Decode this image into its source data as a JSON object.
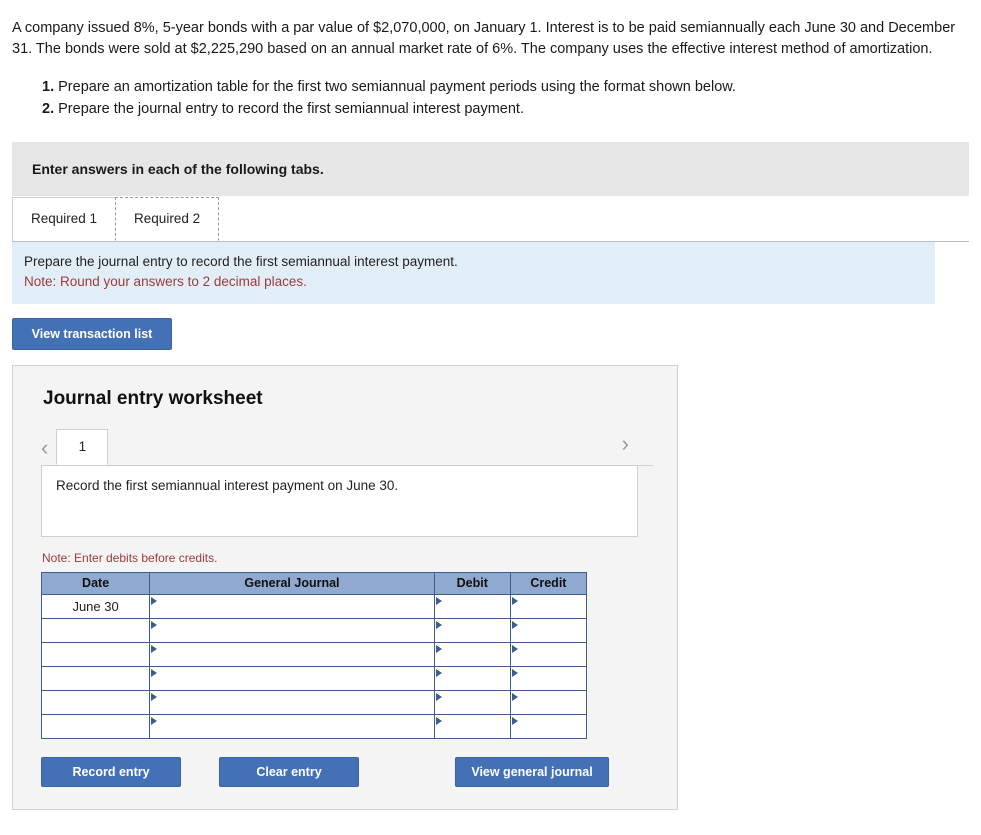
{
  "problem": {
    "text": "A company issued 8%, 5-year bonds with a par value of $2,070,000, on January 1. Interest is to be paid semiannually each June 30 and December 31. The bonds were sold at $2,225,290 based on an annual market rate of 6%. The company uses the effective interest method of amortization.",
    "requirements": [
      {
        "num": "1.",
        "text": "Prepare an amortization table for the first two semiannual payment periods using the format shown below."
      },
      {
        "num": "2.",
        "text": "Prepare the journal entry to record the first semiannual interest payment."
      }
    ]
  },
  "tabs_banner": "Enter answers in each of the following tabs.",
  "tabs": [
    {
      "label": "Required 1",
      "active": false
    },
    {
      "label": "Required 2",
      "active": true
    }
  ],
  "instruction": {
    "main": "Prepare the journal entry to record the first semiannual interest payment.",
    "note": "Note: Round your answers to 2 decimal places."
  },
  "buttons": {
    "view_transaction_list": "View transaction list",
    "record_entry": "Record entry",
    "clear_entry": "Clear entry",
    "view_general_journal": "View general journal"
  },
  "worksheet": {
    "title": "Journal entry worksheet",
    "pager": {
      "prev_icon": "‹",
      "next_icon": "›",
      "pages": [
        "1"
      ]
    },
    "record_text": "Record the first semiannual interest payment on June 30.",
    "debit_note": "Note: Enter debits before credits.",
    "table": {
      "headers": [
        "Date",
        "General Journal",
        "Debit",
        "Credit"
      ],
      "rows": [
        {
          "date": "June 30",
          "general_journal": "",
          "debit": "",
          "credit": ""
        },
        {
          "date": "",
          "general_journal": "",
          "debit": "",
          "credit": ""
        },
        {
          "date": "",
          "general_journal": "",
          "debit": "",
          "credit": ""
        },
        {
          "date": "",
          "general_journal": "",
          "debit": "",
          "credit": ""
        },
        {
          "date": "",
          "general_journal": "",
          "debit": "",
          "credit": ""
        },
        {
          "date": "",
          "general_journal": "",
          "debit": "",
          "credit": ""
        }
      ]
    }
  }
}
